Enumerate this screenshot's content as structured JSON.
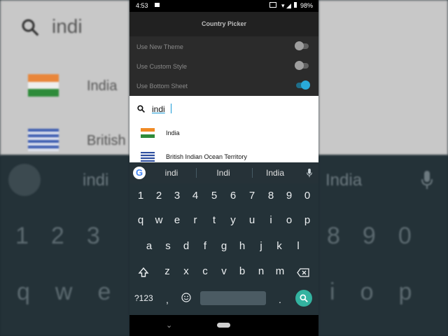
{
  "status_bar": {
    "time": "4:53",
    "battery": "98%"
  },
  "app_bar": {
    "title": "Country Picker"
  },
  "settings": [
    {
      "label": "Use New Theme",
      "enabled": false
    },
    {
      "label": "Use Custom Style",
      "enabled": false
    },
    {
      "label": "Use Bottom Sheet",
      "enabled": true
    }
  ],
  "search": {
    "value": "indi"
  },
  "countries": [
    {
      "name": "India"
    },
    {
      "name": "British Indian Ocean Territory"
    }
  ],
  "keyboard": {
    "suggestions": [
      "indi",
      "Indi",
      "India"
    ],
    "number_row": [
      "1",
      "2",
      "3",
      "4",
      "5",
      "6",
      "7",
      "8",
      "9",
      "0"
    ],
    "row1": [
      "q",
      "w",
      "e",
      "r",
      "t",
      "y",
      "u",
      "i",
      "o",
      "p"
    ],
    "row2": [
      "a",
      "s",
      "d",
      "f",
      "g",
      "h",
      "j",
      "k",
      "l"
    ],
    "row3": [
      "z",
      "x",
      "c",
      "v",
      "b",
      "n",
      "m"
    ],
    "symbols_key": "?123",
    "comma_key": ",",
    "period_key": "."
  },
  "background": {
    "search_text": "indi",
    "country_1": "India",
    "country_2": "British",
    "suggestion_1": "indi",
    "suggestion_2": "India",
    "number_row": [
      "1",
      "2",
      "3",
      "8",
      "9",
      "0"
    ],
    "letter_row": [
      "q",
      "w",
      "e",
      "i",
      "o",
      "p"
    ]
  },
  "colors": {
    "accent": "#29a9d9",
    "keyboard_bg": "#243238",
    "search_key": "#33b3a0"
  }
}
